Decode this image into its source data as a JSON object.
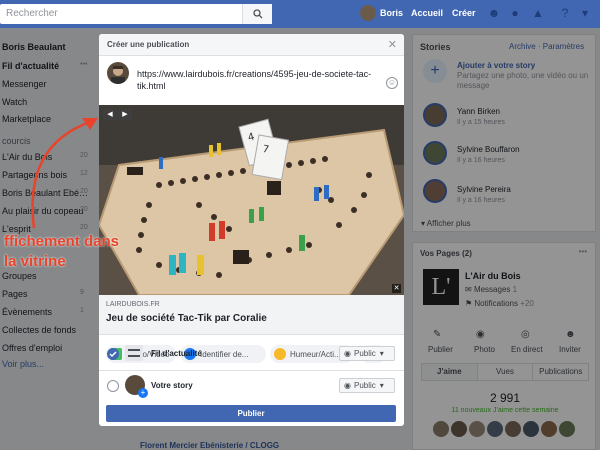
{
  "topbar": {
    "search_placeholder": "Rechercher",
    "user": "Boris",
    "home": "Accueil",
    "create": "Créer"
  },
  "leftnav": {
    "user_name": "Boris Beaulant",
    "items": [
      {
        "label": "Fil d'actualité",
        "count": "•••"
      },
      {
        "label": "Messenger",
        "count": ""
      },
      {
        "label": "Watch",
        "count": ""
      },
      {
        "label": "Marketplace",
        "count": ""
      }
    ],
    "section_raccourcis": "courcis",
    "shortcuts": [
      {
        "label": "L'Air du Bois",
        "count": "20"
      },
      {
        "label": "Partageons bois",
        "count": "12"
      },
      {
        "label": "Boris Beaulant Ebé…",
        "count": "20"
      },
      {
        "label": "Au plaisir du copeau",
        "count": "20"
      },
      {
        "label": "L'esprit",
        "count": "20"
      }
    ],
    "explore": [
      {
        "label": "Groupes"
      },
      {
        "label": "Pages",
        "count": "9"
      },
      {
        "label": "Évènements",
        "count": "1"
      },
      {
        "label": "Collectes de fonds"
      },
      {
        "label": "Offres d'emploi"
      },
      {
        "label": "Voir plus..."
      }
    ]
  },
  "right": {
    "stories_title": "Stories",
    "archive": "Archive · Paramètres",
    "add_story_title": "Ajouter à votre story",
    "add_story_desc": "Partagez une photo, une vidéo ou un message",
    "stories": [
      {
        "name": "Yann Birken",
        "time": "Il y a 15 heures"
      },
      {
        "name": "Sylvine Bouffaron",
        "time": "Il y a 16 heures"
      },
      {
        "name": "Sylvine Pereira",
        "time": "Il y a 16 heures"
      }
    ],
    "see_more": "Afficher plus",
    "pages_title": "Vos Pages (2)",
    "page_name": "L'Air du Bois",
    "messages": "Messages",
    "messages_count": "1",
    "notifications": "Notifications",
    "notif_count": "+20",
    "actions": [
      "Publier",
      "Photo",
      "En direct",
      "Inviter"
    ],
    "tabs": [
      "J'aime",
      "Vues",
      "Publications"
    ],
    "likes": "2 991",
    "likes_sub": "11 nouveaux J'aime cette semaine"
  },
  "modal": {
    "title": "Créer une publication",
    "text": "https://www.lairdubois.fr/creations/4595-jeu-de-societe-tac-tik.html",
    "link_domain": "LAIRDUBOIS.FR",
    "link_title": "Jeu de société Tac-Tik par Coralie",
    "chips": [
      "Photo/Vidéo",
      "Identifier de...",
      "Humeur/Acti...",
      "•••"
    ],
    "destinations": [
      {
        "label": "Fil d'actualité",
        "privacy": "Public"
      },
      {
        "label": "Votre story",
        "privacy": "Public"
      }
    ],
    "publish": "Publier"
  },
  "annotation": "ffichement dans la vitrine",
  "background_post": "Florent Mercier Ebénisterie / CLOGG",
  "colors": {
    "brand": "#4267b2",
    "annotation": "#e8442b",
    "likes_green": "#42b72a"
  }
}
